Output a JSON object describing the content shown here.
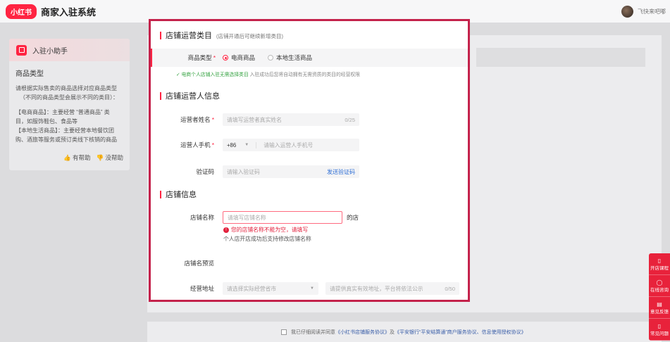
{
  "header": {
    "logo": "小红书",
    "title": "商家入驻系统",
    "username": "飞快来吧嘟"
  },
  "helper": {
    "title": "入驻小助手",
    "section": "商品类型",
    "lines": [
      "请根据实际售卖的商品选择对应商品类型",
      "（不同的商品类型会展示不同的类目）：",
      "",
      "【电商商品】：主要经营 “普通商品” 类",
      "目，如服饰鞋包、食品等",
      "【本地生活商品】：主要经营本地餐饮团",
      "购、酒旅等服务或预订类线下核销的商品"
    ],
    "useful": "有帮助",
    "useless": "没帮助"
  },
  "modal": {
    "sec1": {
      "title": "店铺运营类目",
      "note": "(店铺开通后可继续新增类目)"
    },
    "category": {
      "label": "商品类型",
      "options": [
        "电商商品",
        "本地生活商品"
      ],
      "selected": 0
    },
    "hint": {
      "ok": "电商个人店铺入驻无需选择类目",
      "rest": "入驻成功后您将自动拥有无需资质的类目的经营权限"
    },
    "sec2": {
      "title": "店铺运营人信息"
    },
    "name_field": {
      "label": "运营者姓名",
      "placeholder": "请填写运营者真实姓名",
      "counter": "0/25"
    },
    "phone_field": {
      "label": "运营人手机",
      "code": "+86",
      "placeholder": "请输入运营人手机号"
    },
    "code_field": {
      "label": "验证码",
      "placeholder": "请输入验证码",
      "action": "发送验证码"
    },
    "sec3": {
      "title": "店铺信息"
    },
    "shop_name": {
      "label": "店铺名称",
      "placeholder": "请填写店铺名称",
      "suffix": "的店",
      "error": "您的店铺名称不能为空，请填写",
      "tip": "个人店开店成功后支持修改店铺名称"
    },
    "preview_label": "店铺名预览",
    "address": {
      "label": "经营地址",
      "select_placeholder": "请选择实际经营省市",
      "input_placeholder": "请提供真实有效地址，平台将依法公示",
      "counter": "0/50"
    }
  },
  "footer": {
    "agree_prefix": "我已仔细阅读并同意",
    "link1": "《小红书店铺服务协议》",
    "and": "及",
    "link2": "《平安银行“平安结算通”商户服务协议、信息使用授权协议》"
  },
  "tools": [
    {
      "icon": "book-icon",
      "label": "开店课程"
    },
    {
      "icon": "chat-icon",
      "label": "在线咨询"
    },
    {
      "icon": "feedback-icon",
      "label": "意见反馈"
    },
    {
      "icon": "faq-icon",
      "label": "常见问题"
    }
  ],
  "colors": {
    "accent": "#ff2442",
    "modal_border": "#c4224b",
    "link": "#2f6fd6",
    "error": "#e2203c",
    "success": "#3aa546"
  }
}
